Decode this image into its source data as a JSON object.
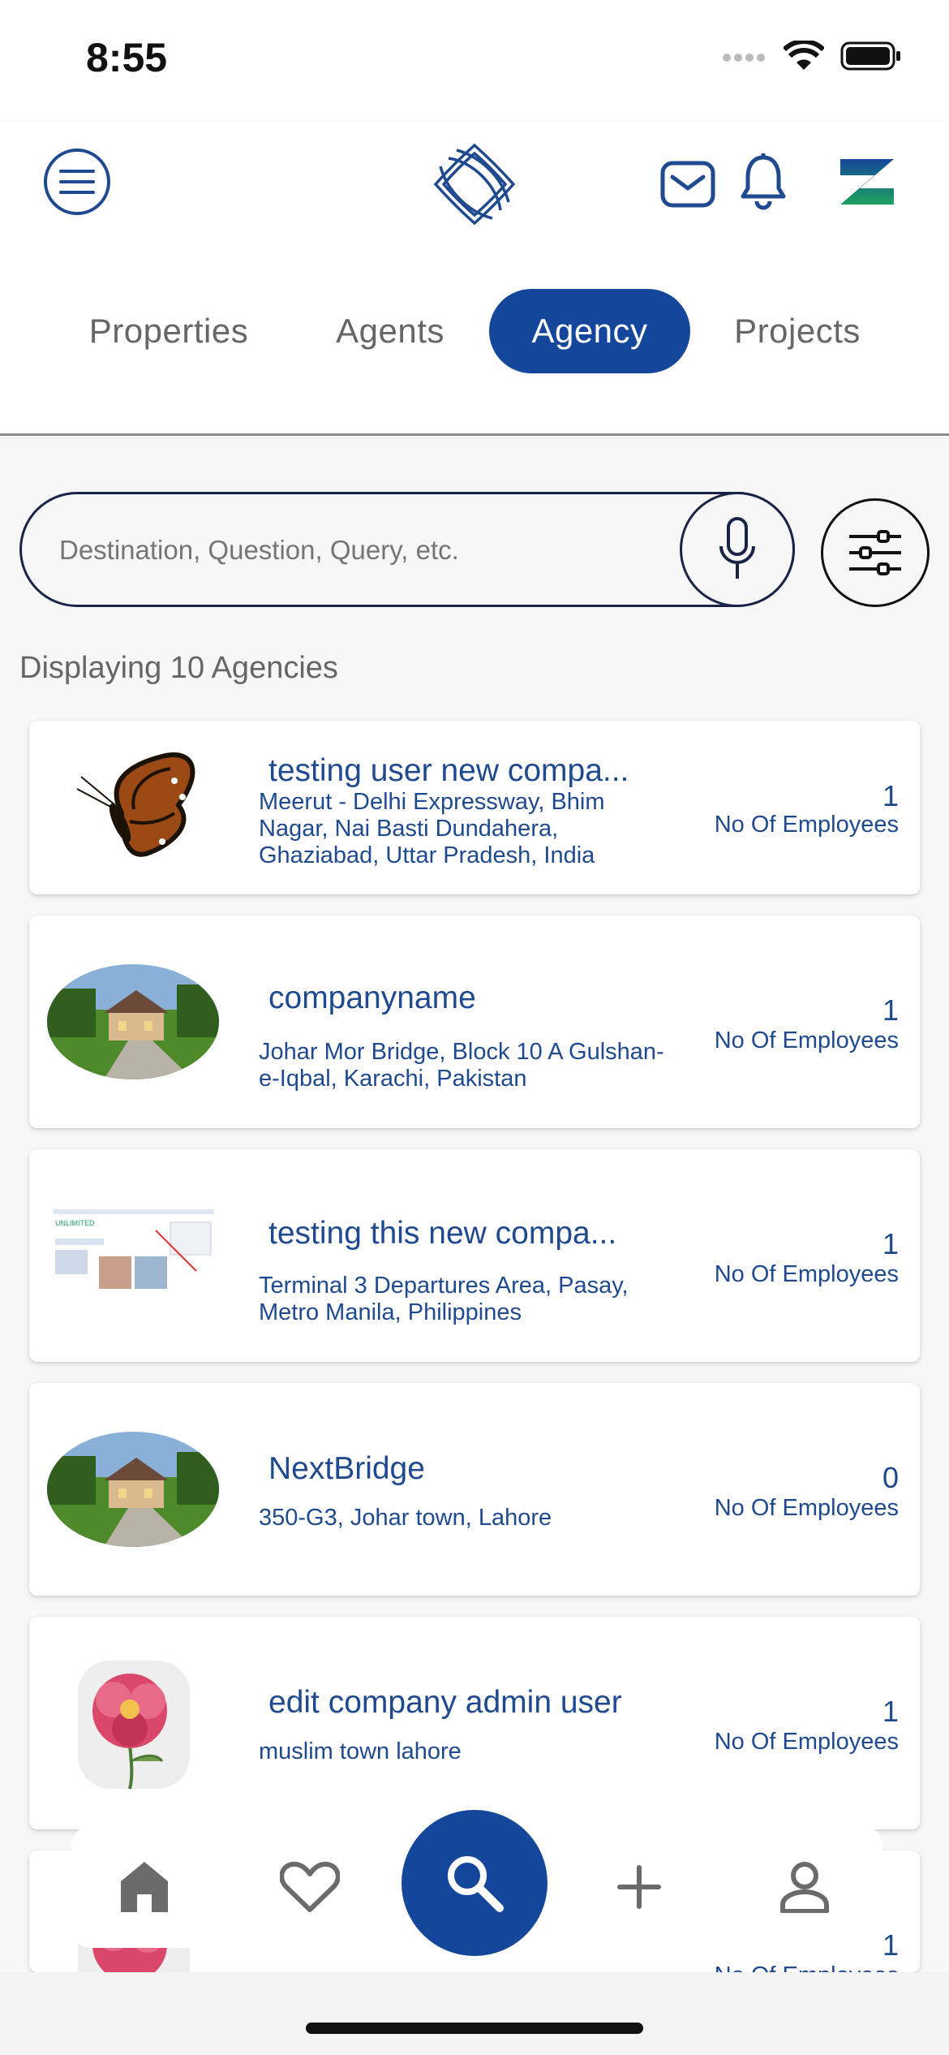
{
  "status_bar": {
    "time": "8:55"
  },
  "header": {
    "menu_icon": "hamburger-icon",
    "logo_icon": "app-logo-icon",
    "mail_icon": "mail-icon",
    "bell_icon": "bell-icon",
    "brand_icon": "brand-z-icon"
  },
  "tabs": [
    {
      "label": "Properties",
      "active": false
    },
    {
      "label": "Agents",
      "active": false
    },
    {
      "label": "Agency",
      "active": true
    },
    {
      "label": "Projects",
      "active": false
    }
  ],
  "search": {
    "placeholder": "Destination, Question, Query, etc."
  },
  "results": {
    "count_text": "Displaying 10 Agencies"
  },
  "agencies": [
    {
      "name": "testing user new compa...",
      "address": "Meerut - Delhi Expressway, Bhim Nagar, Nai Basti Dundahera, Ghaziabad, Uttar Pradesh, India",
      "employees": "1",
      "employees_label": "No Of Employees",
      "image": "butterfly"
    },
    {
      "name": "companyname",
      "address": "Johar Mor Bridge, Block 10 A Gulshan-e-Iqbal, Karachi, Pakistan",
      "employees": "1",
      "employees_label": "No Of Employees",
      "image": "house"
    },
    {
      "name": "testing this new compa...",
      "address": "Terminal 3 Departures Area, Pasay, Metro Manila, Philippines",
      "employees": "1",
      "employees_label": "No Of Employees",
      "image": "screenshot"
    },
    {
      "name": "NextBridge",
      "address": "350-G3, Johar town, Lahore",
      "employees": "0",
      "employees_label": "No Of Employees",
      "image": "house"
    },
    {
      "name": "edit company admin user",
      "address": "muslim town lahore",
      "employees": "1",
      "employees_label": "No Of Employees",
      "image": "flower"
    },
    {
      "name": "",
      "address": "",
      "employees": "1",
      "employees_label": "No Of Employees",
      "image": "flower"
    }
  ],
  "bottom_nav": [
    {
      "icon": "home-icon",
      "active": true
    },
    {
      "icon": "heart-icon",
      "active": false
    },
    {
      "icon": "search-icon",
      "active": true
    },
    {
      "icon": "plus-icon",
      "active": false
    },
    {
      "icon": "profile-icon",
      "active": false
    }
  ],
  "colors": {
    "primary": "#14479b",
    "text_blue": "#1f4a8f",
    "muted": "#666666"
  }
}
